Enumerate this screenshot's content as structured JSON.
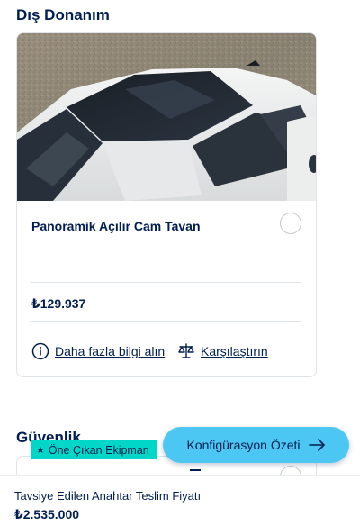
{
  "sections": {
    "exterior_title": "Dış Donanım",
    "security_title": "Güvenlik"
  },
  "option_card": {
    "name": "Panoramik Açılır Cam Tavan",
    "price": "₺129.937",
    "more_info_label": "Daha fazla bilgi alın",
    "compare_label": "Karşılaştırın"
  },
  "badge": {
    "label": "Öne Çıkan Ekipman",
    "icon": "star-icon",
    "color": "#00d7c8"
  },
  "summary_button": {
    "label": "Konfigürasyon Özeti",
    "icon": "arrow-right-icon",
    "color": "#4cc7f4"
  },
  "footer": {
    "label": "Tavsiye Edilen Anahtar Teslim Fiyatı",
    "price": "₺2.535.000"
  },
  "colors": {
    "text": "#001e50",
    "border": "#dfe4e8"
  }
}
